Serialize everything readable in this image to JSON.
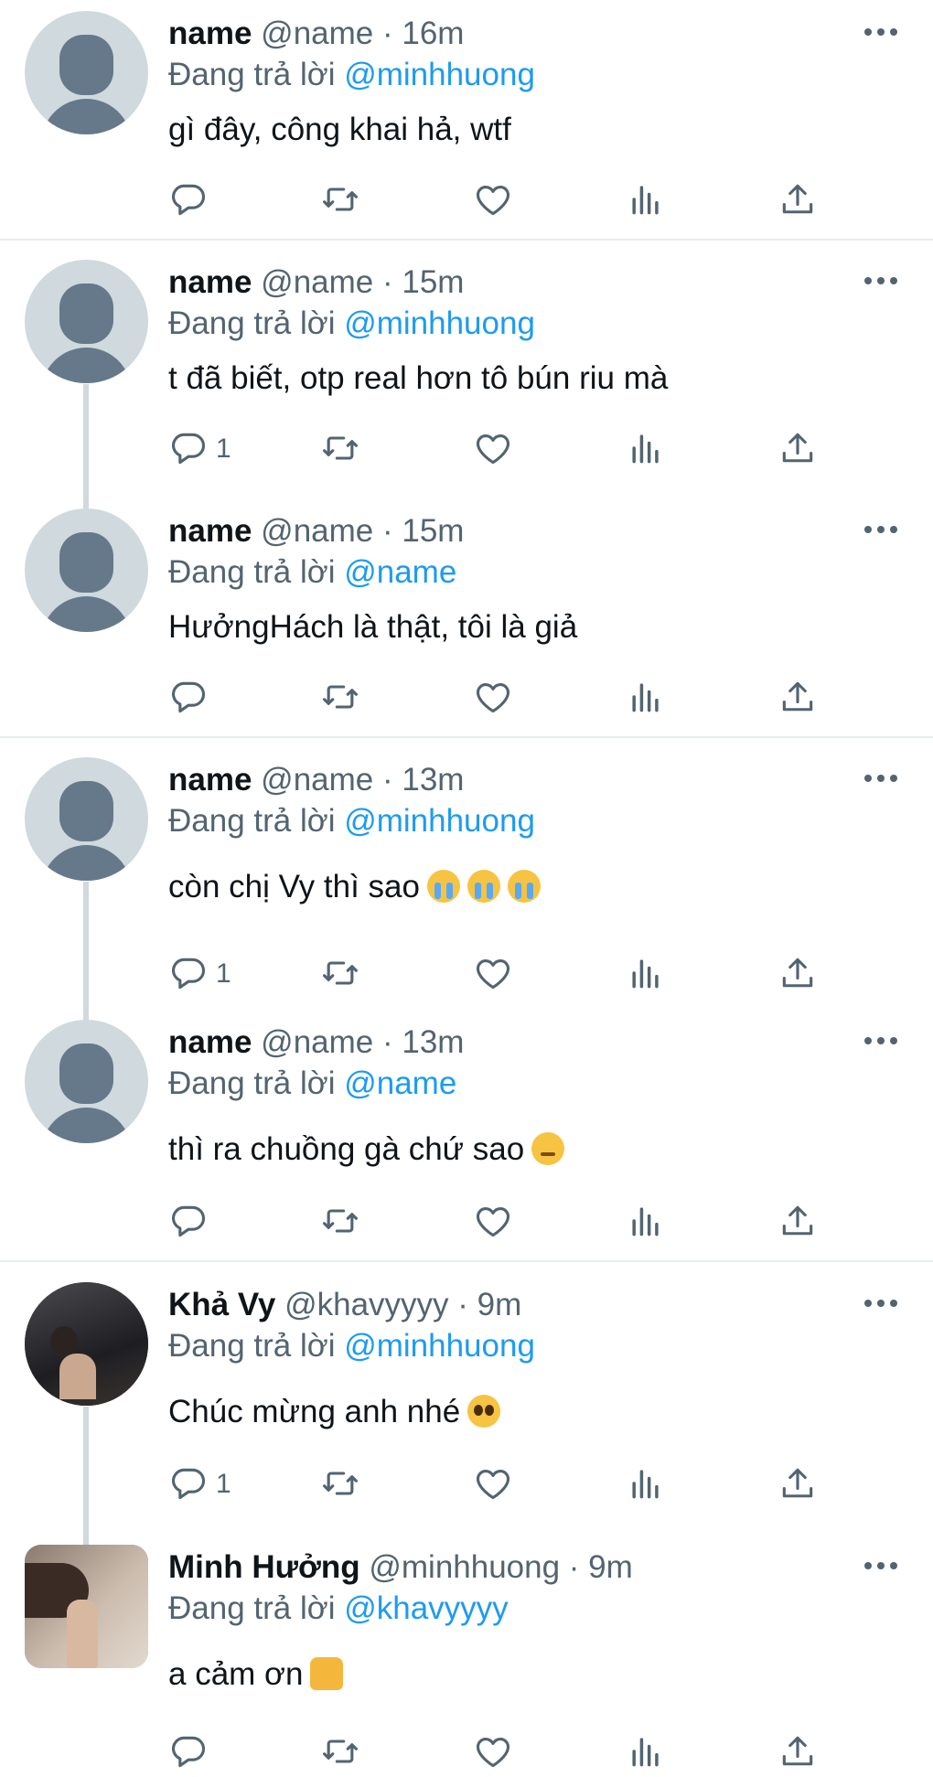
{
  "reply_prefix": "Đang trả lời",
  "tweets": [
    {
      "display_name": "name",
      "meta": "@name · 16m",
      "reply_to": "@minhhuong",
      "text": "gì đây, công khai hả, wtf",
      "reply_count": ""
    },
    {
      "display_name": "name",
      "meta": "@name · 15m",
      "reply_to": "@minhhuong",
      "text": "t đã biết, otp real hơn tô bún riu mà",
      "reply_count": "1"
    },
    {
      "display_name": "name",
      "meta": "@name · 15m",
      "reply_to": "@name",
      "text": "HưởngHách là thật, tôi là giả",
      "reply_count": ""
    },
    {
      "display_name": "name",
      "meta": "@name · 13m",
      "reply_to": "@minhhuong",
      "text": "còn chị Vy thì sao",
      "reply_count": "1"
    },
    {
      "display_name": "name",
      "meta": "@name · 13m",
      "reply_to": "@name",
      "text": "thì ra chuồng gà chứ sao",
      "reply_count": ""
    },
    {
      "display_name": "Khả Vy",
      "meta": "@khavyyyy · 9m",
      "reply_to": "@minhhuong",
      "text": "Chúc mừng anh nhé",
      "reply_count": "1"
    },
    {
      "display_name": "Minh Hưởng",
      "meta": "@minhhuong · 9m",
      "reply_to": "@khavyyyy",
      "text": "a cảm ơn",
      "reply_count": ""
    }
  ],
  "icons": [
    "reply-icon",
    "retweet-icon",
    "like-icon",
    "views-icon",
    "share-icon",
    "more-icon"
  ],
  "colors": {
    "link": "#1d9bf0",
    "secondary": "#536471",
    "avatar_bg": "#cfd9de",
    "avatar_fg": "#66798b"
  }
}
